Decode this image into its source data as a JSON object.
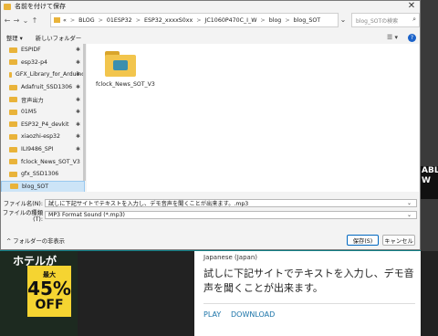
{
  "dialog": {
    "title": "名前を付けて保存",
    "close_glyph": "✕",
    "nav": {
      "back": "←",
      "forward": "→",
      "dropdown": "⌄",
      "up": "↑",
      "refresh": "↻"
    },
    "breadcrumb": [
      "BLOG",
      "01ESP32",
      "ESP32_xxxxS0xx",
      "JC1060P470C_I_W",
      "blog",
      "blog_SOT"
    ],
    "breadcrumb_sep": ">",
    "breadcrumb_overflow": "«",
    "search_placeholder": "blog_SOTの検索",
    "toolbar": {
      "organize": "整理 ▾",
      "new_folder": "新しいフォルダー",
      "view": "☰ ▾",
      "help": "?"
    },
    "sidebar": [
      {
        "label": "ESPIDF",
        "pinned": true
      },
      {
        "label": "esp32-p4",
        "pinned": true
      },
      {
        "label": "GFX_Library_for_Arduino",
        "pinned": true
      },
      {
        "label": "Adafruit_SSD1306",
        "pinned": true
      },
      {
        "label": "音声出力",
        "pinned": true
      },
      {
        "label": "01M5",
        "pinned": true
      },
      {
        "label": "ESP32_P4_devkit",
        "pinned": true
      },
      {
        "label": "xiaozhi-esp32",
        "pinned": true
      },
      {
        "label": "ILI9486_SPI",
        "pinned": true
      },
      {
        "label": "fclock_News_SOT_V3",
        "pinned": false
      },
      {
        "label": "gfx_SSD1306",
        "pinned": false
      },
      {
        "label": "blog_SOT",
        "pinned": false,
        "selected": true
      },
      {
        "label": "blog_ssd1306",
        "pinned": false
      }
    ],
    "pin_glyph": "✱",
    "files": [
      {
        "name": "fclock_News_SOT_V3"
      }
    ],
    "filename_label": "ファイル名(N):",
    "filename_value": "試しに下記サイトでテキストを入力し、デモ音声を聞くことが出来ます。.mp3",
    "filetype_label": "ファイルの種類(T):",
    "filetype_value": "MP3 Format Sound (*.mp3)",
    "chevron_glyph": "⌄",
    "hide_folders": "^ フォルダーの非表示",
    "save_button": "保存(S)",
    "cancel_button": "キャンセル"
  },
  "background": {
    "ad": {
      "title": "ホテルが",
      "small": "最大",
      "percent": "45%",
      "off": "OFF"
    },
    "card": {
      "language": "Japanese (Japan)",
      "text": "試しに下記サイトでテキストを入力し、デモ音声を聞くことが出来ます。",
      "play": "PLAY",
      "download": "DOWNLOAD"
    },
    "peek_right": "ABL\nW",
    "colors": {
      "teal": "#0f7f86",
      "link": "#1a73a8",
      "ad_yellow": "#f5d431"
    }
  }
}
